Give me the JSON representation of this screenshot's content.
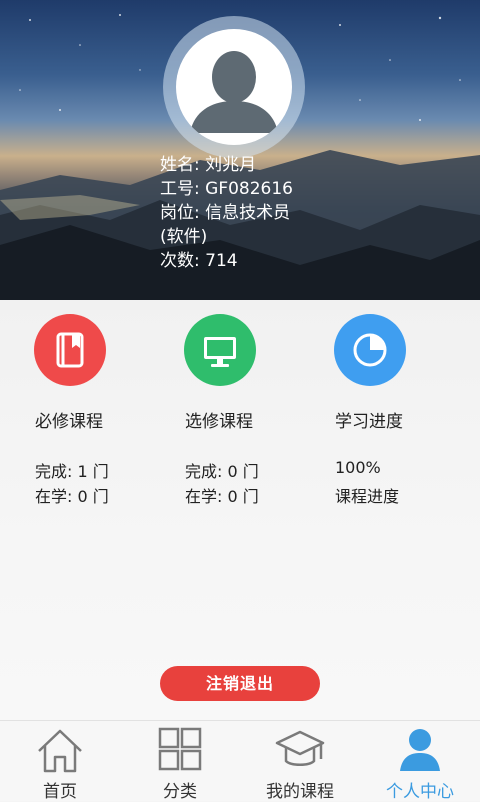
{
  "profile": {
    "name_label": "姓名:",
    "name_value": "刘兆月",
    "id_label": "工号:",
    "id_value": "GF082616",
    "position_label": "岗位:",
    "position_value": "信息技术员",
    "position_extra": "(软件)",
    "count_label": "次数:",
    "count_value": "714"
  },
  "stats": {
    "required": {
      "title": "必修课程",
      "line1": "完成: 1 门",
      "line2": "在学: 0 门",
      "icon": "book-icon",
      "color": "#ef4a4a"
    },
    "elective": {
      "title": "选修课程",
      "line1": "完成: 0 门",
      "line2": "在学: 0 门",
      "icon": "monitor-icon",
      "color": "#2fbd6c"
    },
    "progress": {
      "title": "学习进度",
      "line1": "100%",
      "line2": "课程进度",
      "icon": "pie-chart-icon",
      "color": "#3f9ef0"
    }
  },
  "logout_label": "注销退出",
  "nav": {
    "items": [
      {
        "label": "首页",
        "icon": "home-icon"
      },
      {
        "label": "分类",
        "icon": "grid-icon"
      },
      {
        "label": "我的课程",
        "icon": "graduation-cap-icon"
      },
      {
        "label": "个人中心",
        "icon": "user-icon",
        "active": true
      }
    ],
    "active_color": "#3b9be0"
  }
}
